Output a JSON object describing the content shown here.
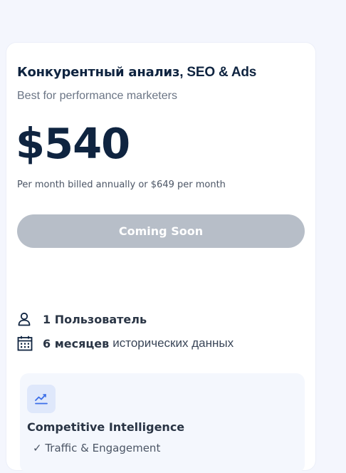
{
  "plan": {
    "title_main": "Конкурентный анализ",
    "title_suffix": ", SEO & Ads",
    "subtitle": "Best for performance marketers",
    "price": "$540",
    "billing": "Per month billed annually or $649 per month",
    "cta_label": "Coming Soon"
  },
  "features": [
    {
      "bold": "1 Пользователь",
      "rest": "",
      "icon": "user-icon"
    },
    {
      "bold": "6 месяцев",
      "rest": "исторических данных",
      "icon": "calendar-icon"
    }
  ],
  "module": {
    "icon": "trend-chart-icon",
    "title": "Competitive Intelligence",
    "first_item": "Traffic & Engagement"
  },
  "colors": {
    "title": "#0f2440",
    "cta_disabled": "#b7bec8",
    "module_bg": "#f4f7fd",
    "icon_accent": "#3b6ee8"
  }
}
